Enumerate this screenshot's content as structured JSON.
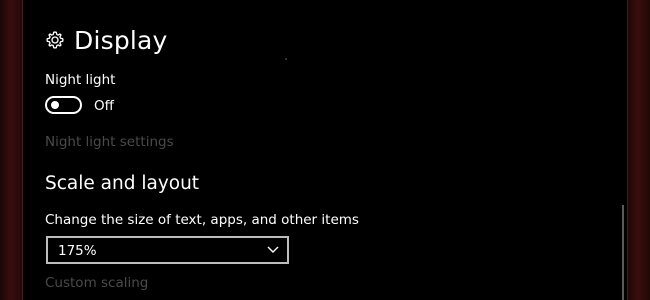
{
  "header": {
    "icon": "gear-icon",
    "title": "Display"
  },
  "night_light": {
    "label": "Night light",
    "toggle_state": "Off",
    "settings_link": "Night light settings"
  },
  "scale_layout": {
    "title": "Scale and layout",
    "size_label": "Change the size of text, apps, and other items",
    "size_selected": "175%",
    "custom_link": "Custom scaling"
  },
  "colors": {
    "background": "#000000",
    "text": "#ffffff",
    "disabled_text": "#4a4a4a",
    "frame": "#3a0d0d"
  }
}
